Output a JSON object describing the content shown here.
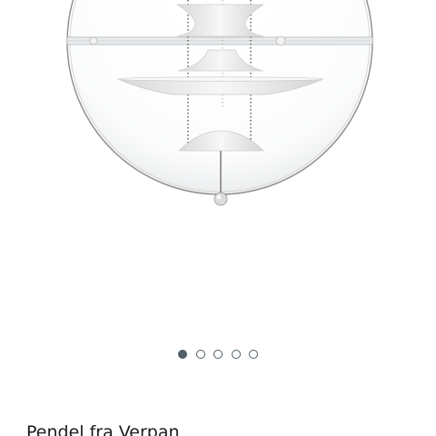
{
  "listing": {
    "title": "Pendel fra Verpan"
  },
  "gallery": {
    "image_count": 5,
    "current_index": 1,
    "active_dot_color": "#4f5f68",
    "image_subject": "glass globe pendant lamp with white shades"
  }
}
